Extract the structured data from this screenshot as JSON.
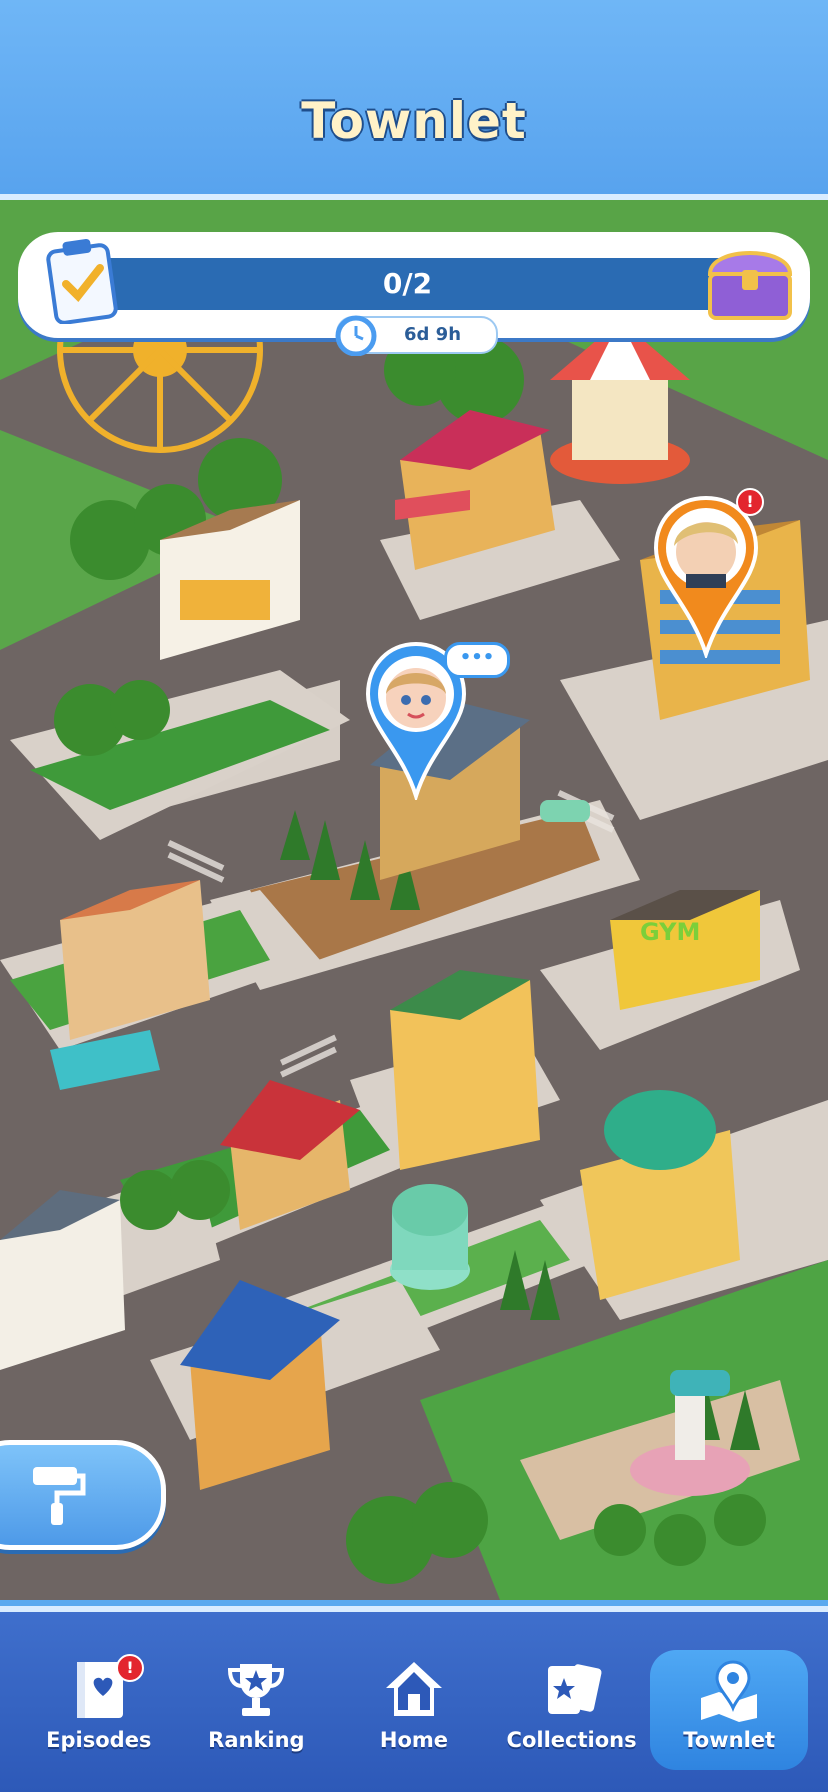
{
  "header": {
    "title": "Townlet"
  },
  "task": {
    "progress_text": "0/2",
    "completed": 0,
    "total": 2,
    "timer": "6d 9h",
    "clipboard_icon": "clipboard-check-icon",
    "reward_icon": "treasure-chest-icon"
  },
  "map": {
    "characters": [
      {
        "name": "female-character",
        "icon": "girl-avatar"
      },
      {
        "name": "male-character",
        "icon": "man-avatar",
        "alert": "!"
      }
    ],
    "gym_sign": "GYM",
    "chat_bubble": "•••"
  },
  "tool_button": {
    "icon": "paint-roller-icon"
  },
  "nav": {
    "items": [
      {
        "label": "Episodes",
        "icon": "book-heart-icon",
        "badge": "!"
      },
      {
        "label": "Ranking",
        "icon": "trophy-icon"
      },
      {
        "label": "Home",
        "icon": "house-icon"
      },
      {
        "label": "Collections",
        "icon": "cards-star-icon"
      },
      {
        "label": "Townlet",
        "icon": "map-pin-icon",
        "active": true
      }
    ]
  },
  "colors": {
    "header": "#5aa9ef",
    "nav_bar": "#2d59b8",
    "active_tab": "#2f84e0",
    "alert": "#e3262e"
  }
}
